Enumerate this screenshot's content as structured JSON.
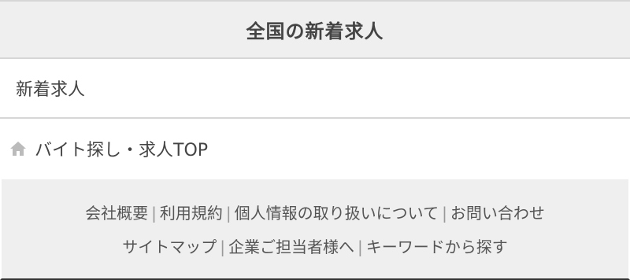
{
  "header": {
    "title": "全国の新着求人"
  },
  "links": {
    "new_jobs": "新着求人",
    "top": "バイト探し・求人TOP"
  },
  "footer": {
    "row1": [
      "会社概要",
      "利用規約",
      "個人情報の取り扱いについて",
      "お問い合わせ"
    ],
    "row2": [
      "サイトマップ",
      "企業ご担当者様へ",
      "キーワードから探す"
    ],
    "separator": "|"
  },
  "icons": {
    "home": "home-icon"
  },
  "colors": {
    "header_bg": "#efefef",
    "text": "#444444",
    "icon": "#bbbbbb"
  }
}
